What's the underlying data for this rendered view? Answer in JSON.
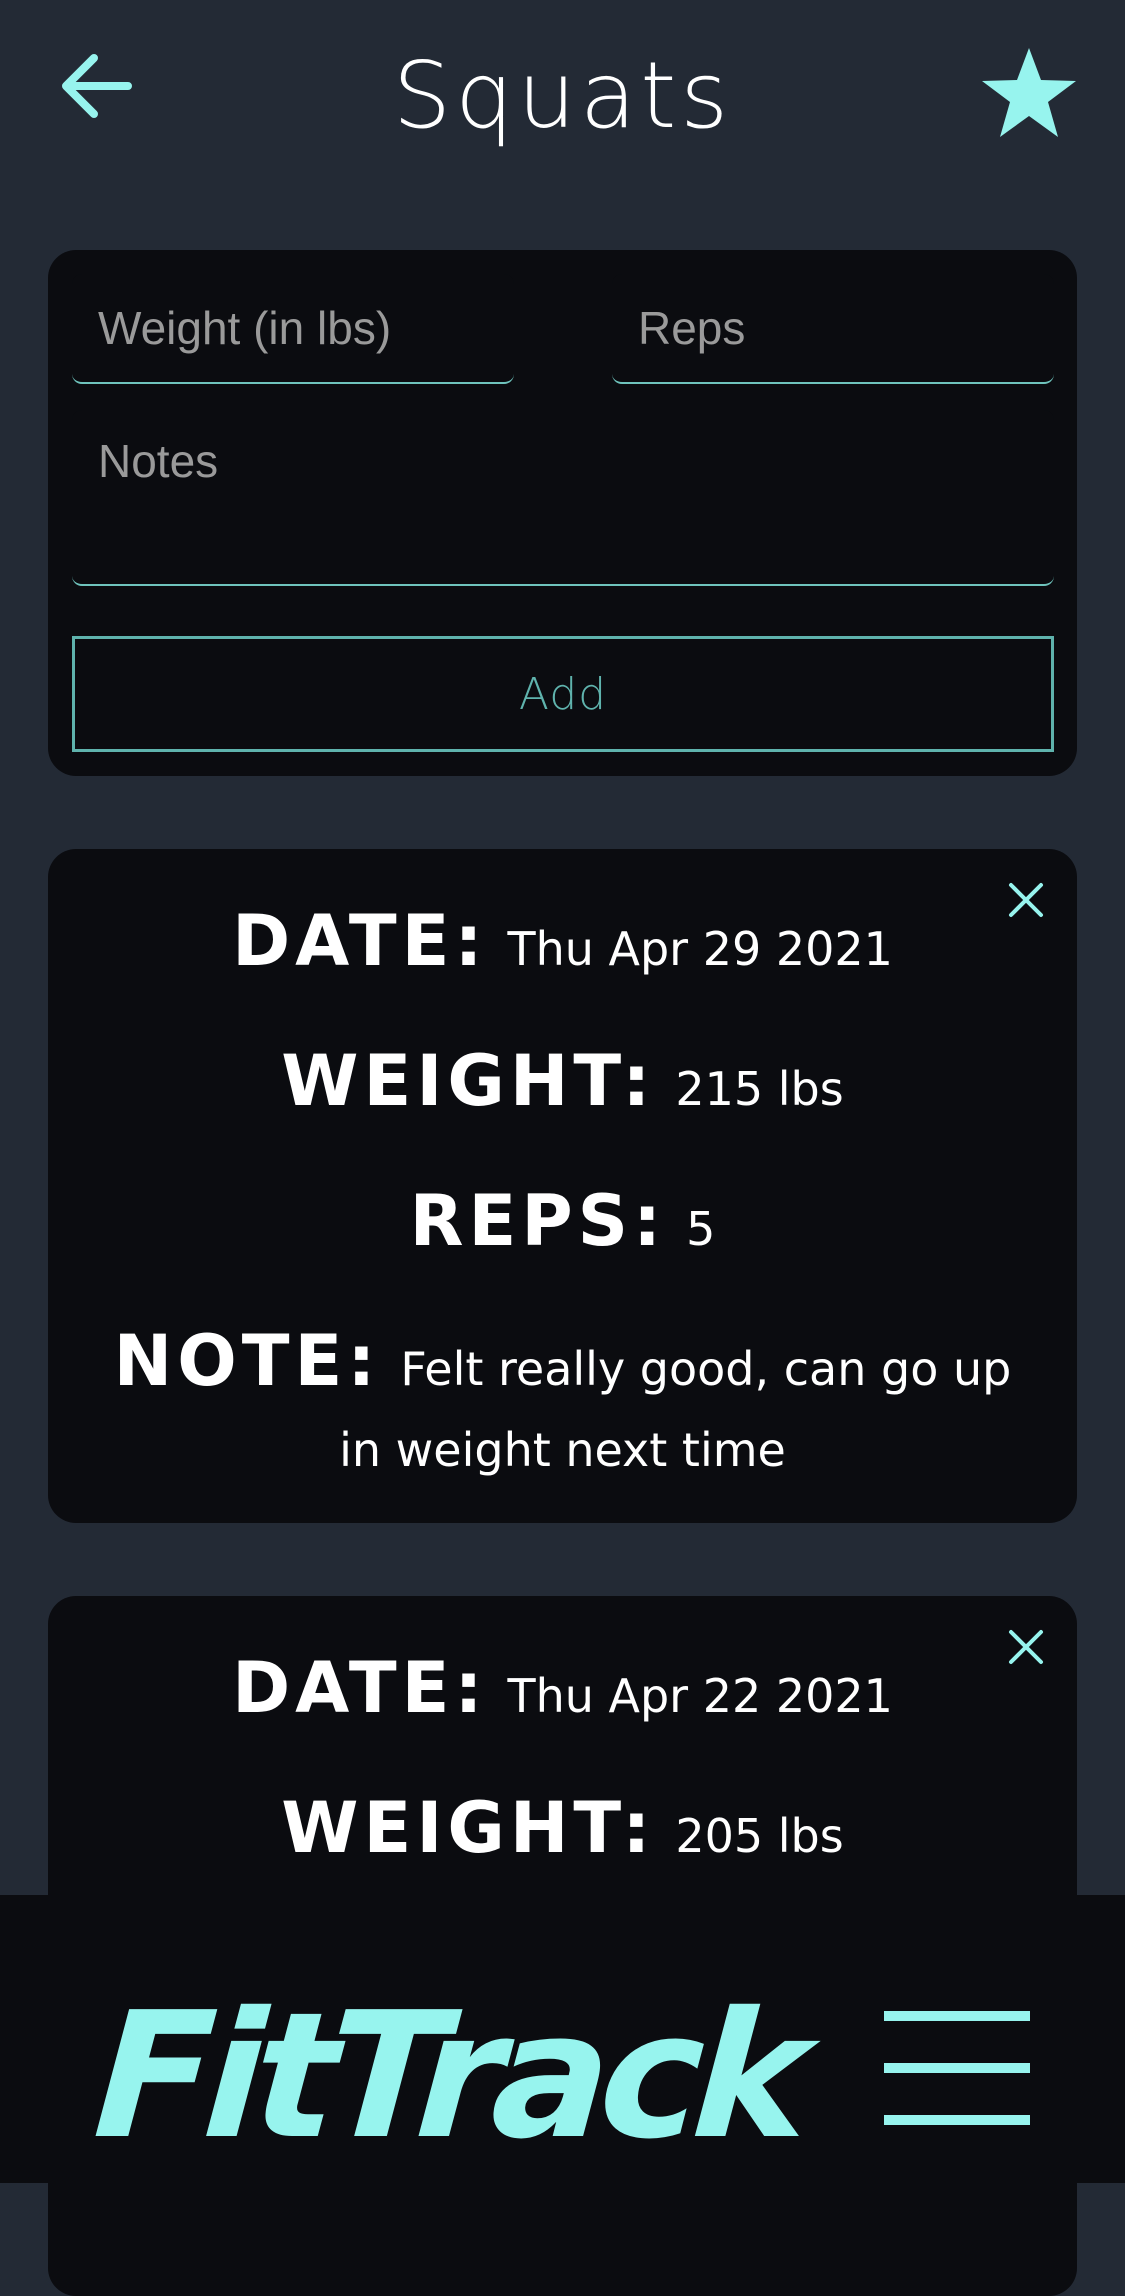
{
  "header": {
    "title": "Squats",
    "back_icon": "arrow-left-icon",
    "favorite_icon": "star-icon"
  },
  "form": {
    "weight_placeholder": "Weight (in lbs)",
    "reps_placeholder": "Reps",
    "notes_placeholder": "Notes",
    "add_label": "Add"
  },
  "labels": {
    "date": "DATE:",
    "weight": "WEIGHT:",
    "reps": "REPS:",
    "note": "NOTE:"
  },
  "entries": [
    {
      "date": "Thu Apr 29 2021",
      "weight": "215 lbs",
      "reps": "5",
      "note": "Felt really good, can go up in weight next time"
    },
    {
      "date": "Thu Apr 22 2021",
      "weight": "205 lbs"
    }
  ],
  "footer": {
    "logo": "FitTrack",
    "menu_icon": "hamburger-menu-icon"
  },
  "colors": {
    "accent": "#97f4ee",
    "field_border": "#6fc4bd",
    "background": "#232a35",
    "card": "#0b0c10"
  }
}
